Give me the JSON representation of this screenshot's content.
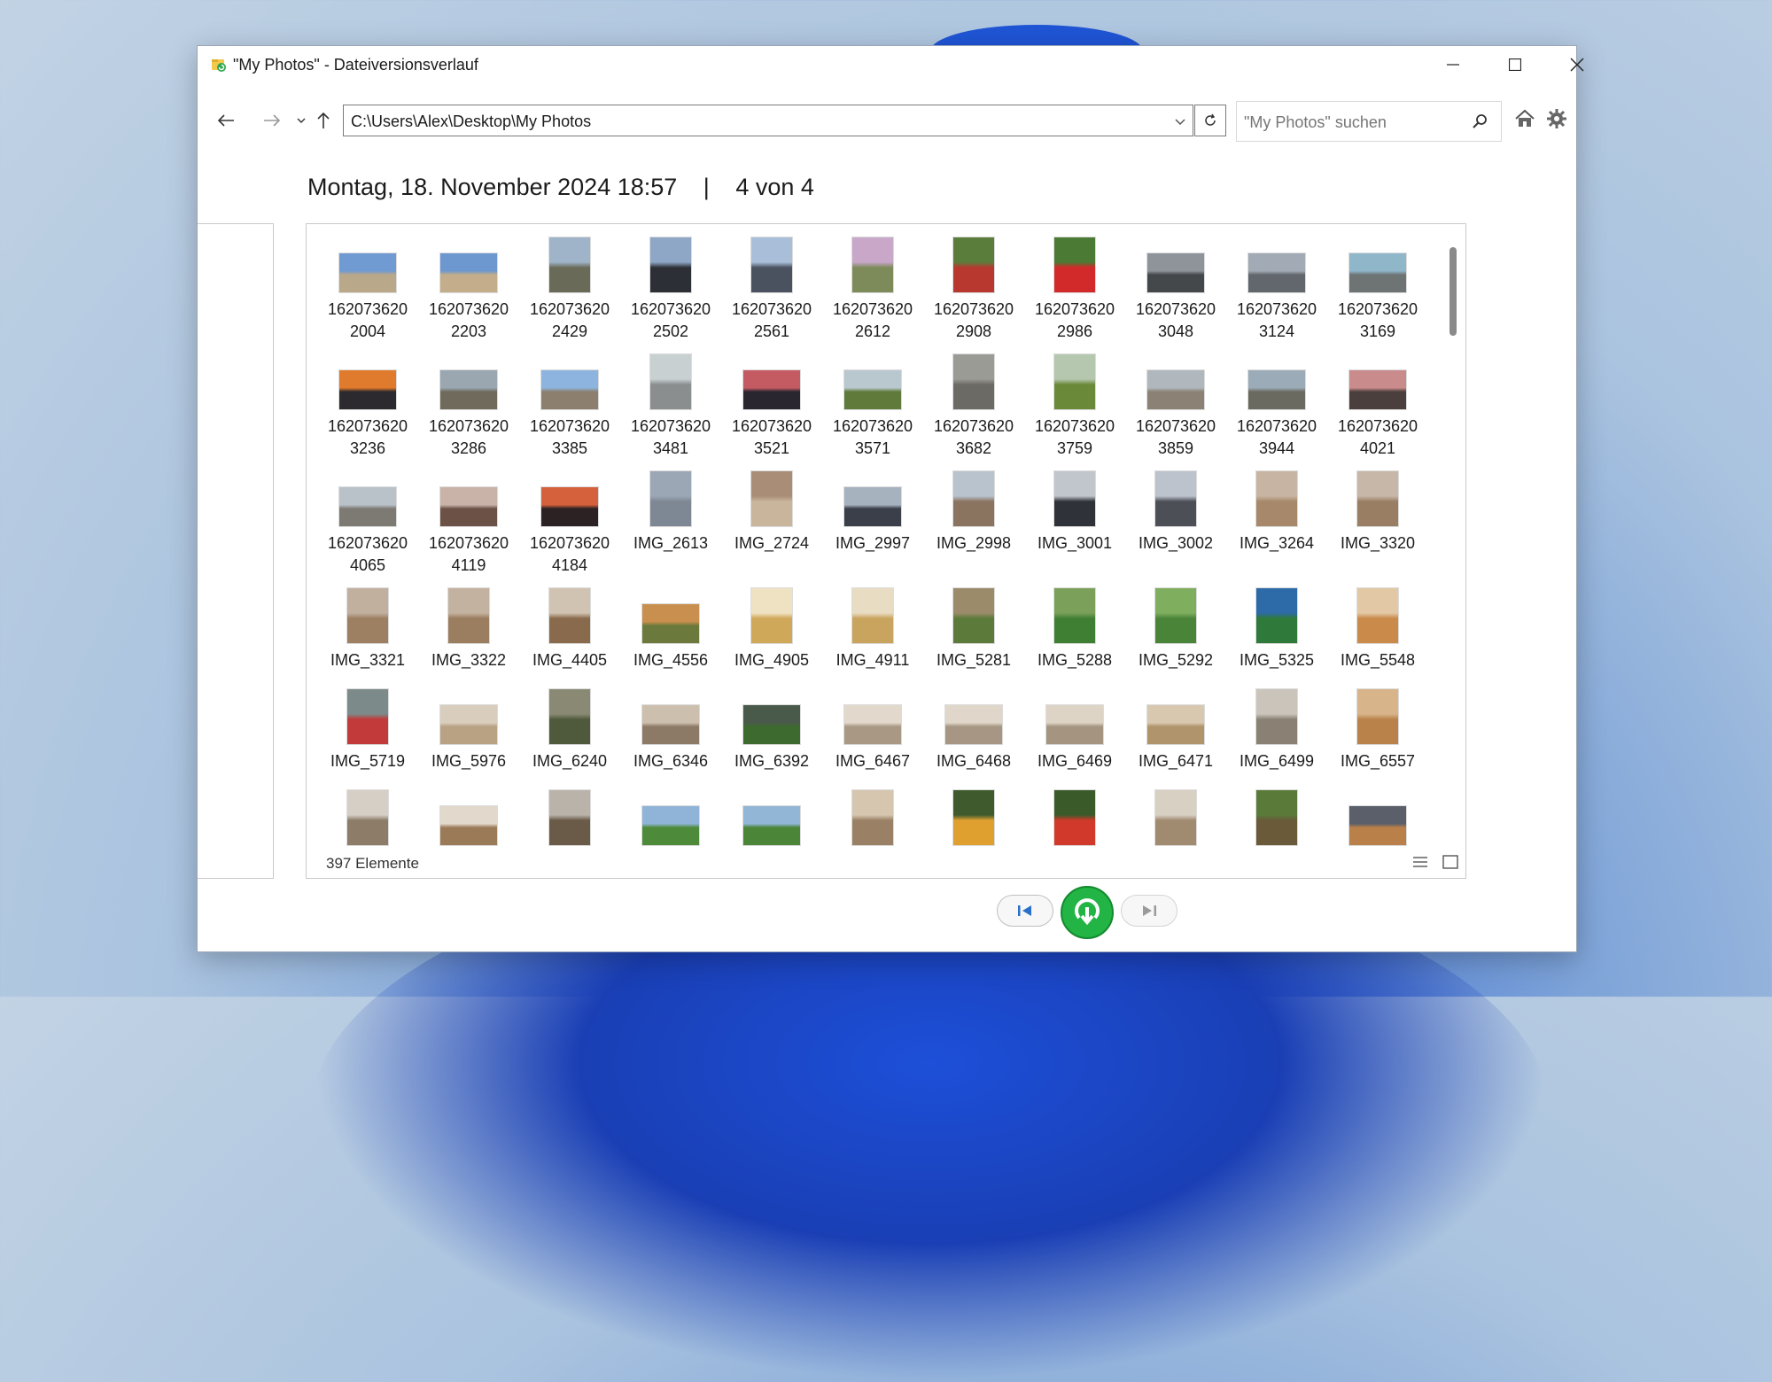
{
  "window": {
    "title": "\"My Photos\" - Dateiversionsverlauf"
  },
  "toolbar": {
    "address": "C:\\Users\\Alex\\Desktop\\My Photos",
    "search_placeholder": "\"My Photos\" suchen"
  },
  "header": {
    "date": "Montag, 18. November 2024 18:57",
    "separator": "|",
    "version": "4 von 4"
  },
  "status": {
    "count": "397 Elemente"
  },
  "items": [
    {
      "label": "162073620\n2004",
      "color": "#b9a88a",
      "sky": "#6f9ad2",
      "w": 66,
      "h": 46
    },
    {
      "label": "162073620\n2203",
      "color": "#c3ad8a",
      "sky": "#6d97cf",
      "w": 66,
      "h": 46
    },
    {
      "label": "162073620\n2429",
      "color": "#6a6a58",
      "sky": "#9fb4c9",
      "w": 48,
      "h": 64
    },
    {
      "label": "162073620\n2502",
      "color": "#2d2f36",
      "sky": "#8ea7c6",
      "w": 48,
      "h": 64
    },
    {
      "label": "162073620\n2561",
      "color": "#4a5260",
      "sky": "#a9bfd9",
      "w": 48,
      "h": 64
    },
    {
      "label": "162073620\n2612",
      "color": "#7d8a5a",
      "sky": "#c8a7c9",
      "w": 48,
      "h": 64
    },
    {
      "label": "162073620\n2908",
      "color": "#b8382f",
      "sky": "#5b7d3c",
      "w": 48,
      "h": 64
    },
    {
      "label": "162073620\n2986",
      "color": "#d22a2a",
      "sky": "#4b7a35",
      "w": 48,
      "h": 64
    },
    {
      "label": "162073620\n3048",
      "color": "#45484b",
      "sky": "#8e949a",
      "w": 66,
      "h": 46
    },
    {
      "label": "162073620\n3124",
      "color": "#62676d",
      "sky": "#a2aab5",
      "w": 66,
      "h": 46
    },
    {
      "label": "162073620\n3169",
      "color": "#6e7474",
      "sky": "#8fb6c9",
      "w": 66,
      "h": 46
    },
    {
      "label": "162073620\n3236",
      "color": "#2c2a2e",
      "sky": "#e07a2c",
      "w": 66,
      "h": 46
    },
    {
      "label": "162073620\n3286",
      "color": "#6f6a5c",
      "sky": "#9aa6b0",
      "w": 66,
      "h": 46
    },
    {
      "label": "162073620\n3385",
      "color": "#8c7f6d",
      "sky": "#8db4de",
      "w": 66,
      "h": 46
    },
    {
      "label": "162073620\n3481",
      "color": "#8a8e8e",
      "sky": "#c9d0d2",
      "w": 48,
      "h": 64
    },
    {
      "label": "162073620\n3521",
      "color": "#2a2630",
      "sky": "#c45a62",
      "w": 66,
      "h": 46
    },
    {
      "label": "162073620\n3571",
      "color": "#5f7a3a",
      "sky": "#b9c7cf",
      "w": 66,
      "h": 46
    },
    {
      "label": "162073620\n3682",
      "color": "#6b6a64",
      "sky": "#9b9b95",
      "w": 48,
      "h": 64
    },
    {
      "label": "162073620\n3759",
      "color": "#6a8a3a",
      "sky": "#b6c7b0",
      "w": 48,
      "h": 64
    },
    {
      "label": "162073620\n3859",
      "color": "#8b8275",
      "sky": "#b0b8be",
      "w": 66,
      "h": 46
    },
    {
      "label": "162073620\n3944",
      "color": "#6b6a60",
      "sky": "#9cabb8",
      "w": 66,
      "h": 46
    },
    {
      "label": "162073620\n4021",
      "color": "#4a3f3d",
      "sky": "#c98b8b",
      "w": 66,
      "h": 46
    },
    {
      "label": "162073620\n4065",
      "color": "#7d7a74",
      "sky": "#b9c1c9",
      "w": 66,
      "h": 46
    },
    {
      "label": "162073620\n4119",
      "color": "#6c5246",
      "sky": "#c9b3a9",
      "w": 66,
      "h": 46
    },
    {
      "label": "162073620\n4184",
      "color": "#2c2223",
      "sky": "#d4603c",
      "w": 66,
      "h": 46
    },
    {
      "label": "IMG_2613",
      "color": "#7e8794",
      "sky": "#9ba7b5",
      "w": 48,
      "h": 64
    },
    {
      "label": "IMG_2724",
      "color": "#c9b59c",
      "sky": "#a98d76",
      "w": 48,
      "h": 64
    },
    {
      "label": "IMG_2997",
      "color": "#3a3f49",
      "sky": "#a7b2bf",
      "w": 66,
      "h": 46
    },
    {
      "label": "IMG_2998",
      "color": "#8a7460",
      "sky": "#b9c3ce",
      "w": 48,
      "h": 64
    },
    {
      "label": "IMG_3001",
      "color": "#2f3238",
      "sky": "#c1c6cc",
      "w": 48,
      "h": 64
    },
    {
      "label": "IMG_3002",
      "color": "#4c4f56",
      "sky": "#bcc3cc",
      "w": 48,
      "h": 64
    },
    {
      "label": "IMG_3264",
      "color": "#a7886a",
      "sky": "#c8b4a2",
      "w": 48,
      "h": 64
    },
    {
      "label": "IMG_3320",
      "color": "#9a7e63",
      "sky": "#c7b7a8",
      "w": 48,
      "h": 64
    },
    {
      "label": "IMG_3321",
      "color": "#9d7f62",
      "sky": "#c2b09f",
      "w": 48,
      "h": 64
    },
    {
      "label": "IMG_3322",
      "color": "#9b7d60",
      "sky": "#c4b2a0",
      "w": 48,
      "h": 64
    },
    {
      "label": "IMG_4405",
      "color": "#8a6a4c",
      "sky": "#d1c3b2",
      "w": 48,
      "h": 64
    },
    {
      "label": "IMG_4556",
      "color": "#6b7a3c",
      "sky": "#c98f4e",
      "w": 66,
      "h": 46
    },
    {
      "label": "IMG_4905",
      "color": "#d0a85a",
      "sky": "#efe2c2",
      "w": 48,
      "h": 64
    },
    {
      "label": "IMG_4911",
      "color": "#c9a45e",
      "sky": "#e8dcc3",
      "w": 48,
      "h": 64
    },
    {
      "label": "IMG_5281",
      "color": "#5c7a3a",
      "sky": "#9b8b6a",
      "w": 48,
      "h": 64
    },
    {
      "label": "IMG_5288",
      "color": "#3f7f34",
      "sky": "#7aa05a",
      "w": 48,
      "h": 64
    },
    {
      "label": "IMG_5292",
      "color": "#4a8438",
      "sky": "#7fae5e",
      "w": 48,
      "h": 64
    },
    {
      "label": "IMG_5325",
      "color": "#2f7a3a",
      "sky": "#2d6aa8",
      "w": 48,
      "h": 64
    },
    {
      "label": "IMG_5548",
      "color": "#c98a4a",
      "sky": "#e3c8a6",
      "w": 48,
      "h": 64
    },
    {
      "label": "IMG_5719",
      "color": "#c23a3a",
      "sky": "#7c8a8a",
      "w": 48,
      "h": 64
    },
    {
      "label": "IMG_5976",
      "color": "#b9a284",
      "sky": "#d9cdbd",
      "w": 66,
      "h": 46
    },
    {
      "label": "IMG_6240",
      "color": "#4f5a3c",
      "sky": "#8a8a74",
      "w": 48,
      "h": 64
    },
    {
      "label": "IMG_6346",
      "color": "#8d7a66",
      "sky": "#cdbfae",
      "w": 66,
      "h": 46
    },
    {
      "label": "IMG_6392",
      "color": "#3d6a2e",
      "sky": "#4a5a4a",
      "w": 66,
      "h": 46
    },
    {
      "label": "IMG_6467",
      "color": "#a89884",
      "sky": "#e2d8cc",
      "w": 66,
      "h": 46
    },
    {
      "label": "IMG_6468",
      "color": "#a69683",
      "sky": "#e0d6c9",
      "w": 66,
      "h": 46
    },
    {
      "label": "IMG_6469",
      "color": "#a49480",
      "sky": "#ded4c6",
      "w": 66,
      "h": 46
    },
    {
      "label": "IMG_6471",
      "color": "#b0946c",
      "sky": "#d9c8b0",
      "w": 66,
      "h": 46
    },
    {
      "label": "IMG_6499",
      "color": "#8a8174",
      "sky": "#cbc4ba",
      "w": 48,
      "h": 64
    },
    {
      "label": "IMG_6557",
      "color": "#b9824a",
      "sky": "#d7b48a",
      "w": 48,
      "h": 64
    },
    {
      "label": "",
      "color": "#8c7c68",
      "sky": "#d6cfc6",
      "w": 48,
      "h": 64
    },
    {
      "label": "",
      "color": "#9b7a58",
      "sky": "#e2d8cc",
      "w": 66,
      "h": 46
    },
    {
      "label": "",
      "color": "#6a5a48",
      "sky": "#b9b3aa",
      "w": 48,
      "h": 64
    },
    {
      "label": "",
      "color": "#4d8a3a",
      "sky": "#8fb4d8",
      "w": 66,
      "h": 46
    },
    {
      "label": "",
      "color": "#4a8538",
      "sky": "#92b6d6",
      "w": 66,
      "h": 46
    },
    {
      "label": "",
      "color": "#9a8064",
      "sky": "#d6c6b0",
      "w": 48,
      "h": 64
    },
    {
      "label": "",
      "color": "#e0a030",
      "sky": "#3f5a2c",
      "w": 48,
      "h": 64
    },
    {
      "label": "",
      "color": "#d13a2a",
      "sky": "#3a5a2a",
      "w": 48,
      "h": 64
    },
    {
      "label": "",
      "color": "#a08a70",
      "sky": "#d9d0c4",
      "w": 48,
      "h": 64
    },
    {
      "label": "",
      "color": "#6a5a3a",
      "sky": "#5a7a3a",
      "w": 48,
      "h": 64
    },
    {
      "label": "",
      "color": "#b9804a",
      "sky": "#5a5f6a",
      "w": 66,
      "h": 46
    }
  ],
  "icons": {
    "back": "arrow-left",
    "forward": "arrow-right",
    "recent": "chevron-down",
    "up": "arrow-up",
    "refresh": "refresh",
    "search": "magnifier",
    "home": "house",
    "settings": "gear",
    "restore": "circular-arrow"
  },
  "colors": {
    "restore_button": "#22b445"
  }
}
